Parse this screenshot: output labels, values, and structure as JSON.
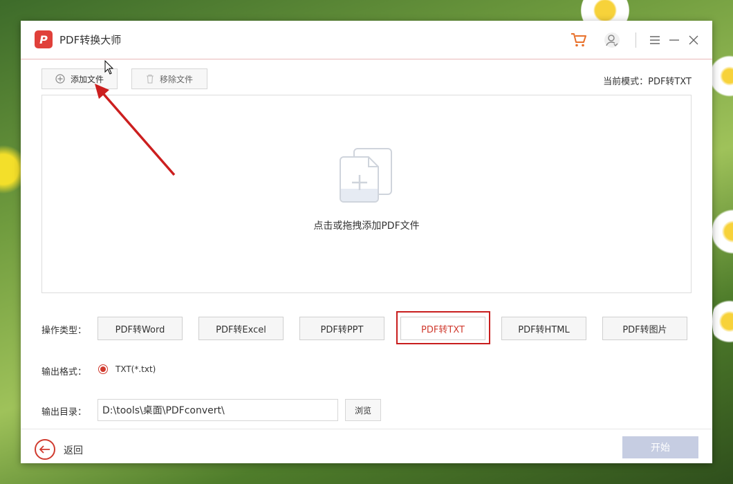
{
  "app": {
    "title": "PDF转换大师",
    "logo_letter": "P"
  },
  "toolbar": {
    "add_file": "添加文件",
    "remove_file": "移除文件"
  },
  "current_mode": "当前模式：PDF转TXT",
  "dropzone": {
    "hint": "点击或拖拽添加PDF文件"
  },
  "operation": {
    "label": "操作类型：",
    "types": [
      "PDF转Word",
      "PDF转Excel",
      "PDF转PPT",
      "PDF转TXT",
      "PDF转HTML",
      "PDF转图片"
    ],
    "selected": "PDF转TXT"
  },
  "output_format": {
    "label": "输出格式：",
    "option": "TXT(*.txt)",
    "selected": true
  },
  "output_dir": {
    "label": "输出目录：",
    "value": "D:\\tools\\桌面\\PDFconvert\\",
    "browse": "浏览"
  },
  "footer": {
    "back": "返回",
    "start": "开始"
  },
  "colors": {
    "accent": "#d03a2e",
    "highlight_frame": "#c81d1d",
    "start_disabled": "#c6cde2"
  },
  "icons": [
    "logo-icon",
    "cart-icon",
    "user-icon",
    "menu-icon",
    "minimize-icon",
    "close-icon",
    "plus-circle-icon",
    "trash-icon",
    "add-document-icon",
    "back-arrow-icon"
  ]
}
